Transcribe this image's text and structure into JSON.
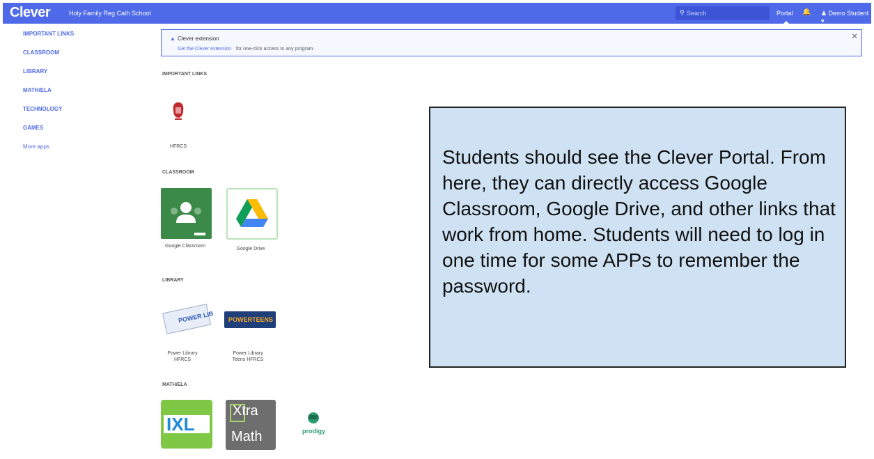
{
  "header": {
    "logo": "Clever",
    "school": "Holy Family Reg Cath School",
    "search_placeholder": "Search",
    "nav_portal": "Portal",
    "user_menu": "Demo Student ▾",
    "accent": "#4f6ae8"
  },
  "sidebar": {
    "items": [
      {
        "label": "IMPORTANT LINKS"
      },
      {
        "label": "CLASSROOM"
      },
      {
        "label": "LIBRARY"
      },
      {
        "label": "MATH/ELA"
      },
      {
        "label": "TECHNOLOGY"
      },
      {
        "label": "GAMES"
      },
      {
        "label": "More apps"
      }
    ]
  },
  "alert": {
    "title": "Clever extension",
    "link_text": "Get the Clever extension",
    "rest_text": "for one-click access to any program."
  },
  "sections": {
    "important_links": {
      "label": "IMPORTANT LINKS",
      "apps": [
        {
          "label": "HFRCS"
        }
      ]
    },
    "classroom": {
      "label": "CLASSROOM",
      "apps": [
        {
          "label": "Google Classroom"
        },
        {
          "label": "Google Drive"
        }
      ]
    },
    "library": {
      "label": "LIBRARY",
      "apps": [
        {
          "label": "Power Library HFRCS",
          "logo_text": "POWER LIBRARY"
        },
        {
          "label": "Power Library Teens HFRCS",
          "logo_text": "POWERTEENS"
        }
      ]
    },
    "math_ela": {
      "label": "MATH/ELA",
      "apps": [
        {
          "label": "IXL",
          "logo_text": "IXL"
        },
        {
          "label": "XtraMath",
          "logo_text_1": "Xtra",
          "logo_text_2": "Math"
        },
        {
          "label": "Prodigy",
          "logo_text": "prodigy"
        }
      ]
    }
  },
  "callout": {
    "text": "Students should see the Clever Portal.  From here, they can directly access Google Classroom, Google Drive, and other links that work from home.  Students will need to log in one time for some APPs to remember the password."
  }
}
